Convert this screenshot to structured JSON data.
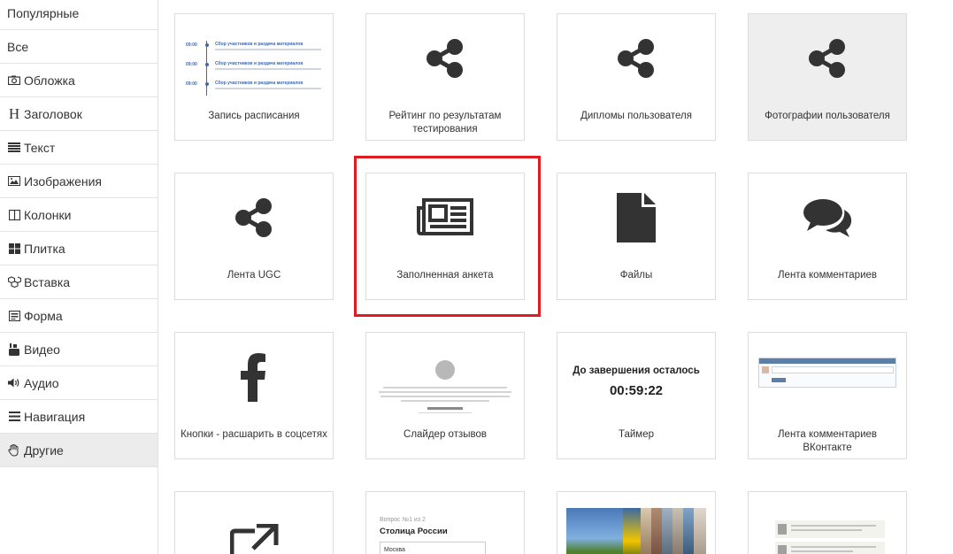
{
  "sidebar": {
    "items": [
      {
        "label": "Популярные",
        "icon": "none"
      },
      {
        "label": "Все",
        "icon": "none"
      },
      {
        "label": "Обложка",
        "icon": "camera-icon"
      },
      {
        "label": "Заголовок",
        "icon": "heading-icon",
        "letter": "H"
      },
      {
        "label": "Текст",
        "icon": "text-lines-icon"
      },
      {
        "label": "Изображения",
        "icon": "image-icon"
      },
      {
        "label": "Колонки",
        "icon": "columns-icon"
      },
      {
        "label": "Плитка",
        "icon": "tiles-icon"
      },
      {
        "label": "Вставка",
        "icon": "cubes-icon"
      },
      {
        "label": "Форма",
        "icon": "form-icon"
      },
      {
        "label": "Видео",
        "icon": "youtube-icon"
      },
      {
        "label": "Аудио",
        "icon": "volume-icon"
      },
      {
        "label": "Навигация",
        "icon": "bars-icon"
      },
      {
        "label": "Другие",
        "icon": "hand-icon",
        "active": true
      }
    ]
  },
  "cards": {
    "schedule": {
      "label": "Запись расписания",
      "times": [
        "09:00",
        "09:00",
        "09:00"
      ],
      "heading": "Сбор участников и раздача материалов"
    },
    "rating": {
      "label": "Рейтинг по результатам тестирования"
    },
    "diplomas": {
      "label": "Дипломы пользователя"
    },
    "photos": {
      "label": "Фотографии пользователя"
    },
    "ugc": {
      "label": "Лента UGC"
    },
    "filled_form": {
      "label": "Заполненная анкета"
    },
    "files": {
      "label": "Файлы"
    },
    "comments": {
      "label": "Лента комментариев"
    },
    "share": {
      "label": "Кнопки - расшарить в соцсетях"
    },
    "testimonials": {
      "label": "Слайдер отзывов"
    },
    "timer": {
      "label": "Таймер",
      "title": "До завершения осталось",
      "value": "00:59:22"
    },
    "vk": {
      "label": "Лента комментариев ВКонтакте"
    },
    "quiz": {
      "question_number": "Вопрос №1 из 2",
      "question": "Столица России",
      "answer": "Москва"
    }
  },
  "colors": {
    "highlight": "#e11b22",
    "icon": "#333333",
    "active_bg": "#ececec",
    "accent_blue": "#3d6bb3"
  }
}
